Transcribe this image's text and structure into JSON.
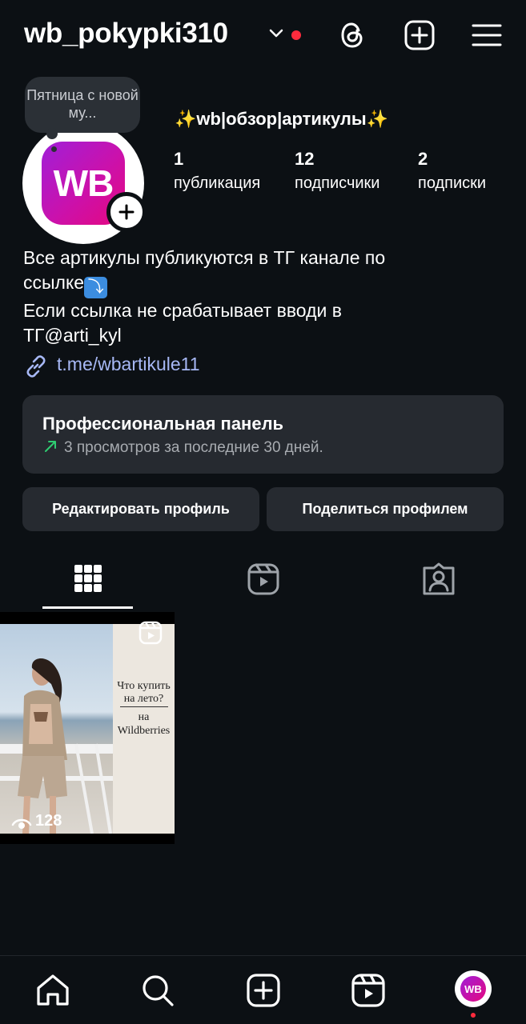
{
  "header": {
    "username": "wb_pokypki310",
    "icons": [
      "chevron-down-icon",
      "threads-icon",
      "create-icon",
      "menu-icon"
    ],
    "notification_color": "#ff2b3d"
  },
  "profile": {
    "avatar_text": "WB",
    "note": "Пятница с новой му...",
    "display_name": "✨wb|обзор|артикулы✨",
    "stats": [
      {
        "value": "1",
        "label": "публикация"
      },
      {
        "value": "12",
        "label": "подписчики"
      },
      {
        "value": "2",
        "label": "подписки"
      }
    ],
    "bio_line1": "Все артикулы публикуются в ТГ канале по",
    "bio_line2": "ссылке",
    "bio_emoji": "⤵",
    "bio_line3": "Если ссылка не срабатывает вводи в",
    "bio_line4": "ТГ@arti_kyl",
    "link": "t.me/wbartikule11"
  },
  "pro_panel": {
    "title": "Профессиональная панель",
    "subtitle": "3 просмотров за последние 30 дней."
  },
  "buttons": {
    "edit": "Редактировать профиль",
    "share": "Поделиться профилем"
  },
  "tabs": [
    "grid-icon",
    "reels-icon",
    "tagged-icon"
  ],
  "posts": [
    {
      "title_line1": "Что купить",
      "title_line2": "на лето?",
      "sub_line1": "на",
      "sub_line2": "Wildberries",
      "views": "128"
    }
  ],
  "bottom_nav": {
    "items": [
      "home-icon",
      "search-icon",
      "create-icon",
      "reels-icon",
      "profile-avatar"
    ],
    "avatar_text": "WB"
  },
  "colors": {
    "background": "#0c1014",
    "panel": "#262a30",
    "link": "#a7b8f5",
    "brand_gradient_start": "#a01fd8",
    "brand_gradient_end": "#e5087f"
  }
}
